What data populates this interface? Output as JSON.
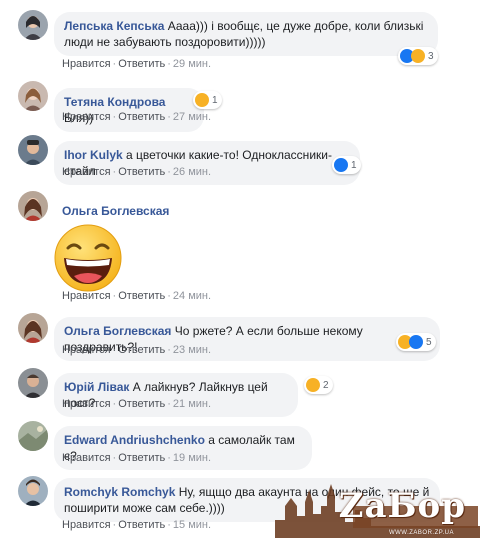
{
  "comments": [
    {
      "author": "Лепська Кепська",
      "text": "Аааа))) і вообщє, це дуже добре, коли близькі люди не забувають поздоровити)))))",
      "like_label": "Нравится",
      "reply_label": "Ответить",
      "time": "29 мин.",
      "reaction_count": "3",
      "reaction_icons": [
        "like-icon",
        "haha-icon"
      ]
    },
    {
      "author": "Тетяна Кондрова",
      "text": "Бля))",
      "like_label": "Нравится",
      "reply_label": "Ответить",
      "time": "27 мин.",
      "reaction_count": "1",
      "reaction_icons": [
        "haha-icon"
      ]
    },
    {
      "author": "Ihor Kulyk",
      "text": "а цветочки какие-то! Одноклассники-стайл",
      "like_label": "Нравится",
      "reply_label": "Ответить",
      "time": "26 мин.",
      "reaction_count": "1",
      "reaction_icons": [
        "like-icon"
      ]
    },
    {
      "author": "Ольга Боглевская",
      "text": "",
      "sticker": "laughing-face-sticker",
      "like_label": "Нравится",
      "reply_label": "Ответить",
      "time": "24 мин."
    },
    {
      "author": "Ольга Боглевская",
      "text": "Чо ржете? А если больше некому поздравить?!",
      "like_label": "Нравится",
      "reply_label": "Ответить",
      "time": "23 мин.",
      "reaction_count": "5",
      "reaction_icons": [
        "haha-icon",
        "like-icon"
      ]
    },
    {
      "author": "Юрій Лівак",
      "text": "А лайкнув? Лайкнув цей пост?",
      "like_label": "Нравится",
      "reply_label": "Ответить",
      "time": "21 мин.",
      "reaction_count": "2",
      "reaction_icons": [
        "haha-icon"
      ]
    },
    {
      "author": "Edward Andriushchenko",
      "text": "а самолайк там є?",
      "like_label": "Нравится",
      "reply_label": "Ответить",
      "time": "19 мин."
    },
    {
      "author": "Romchyk Romchyk",
      "text": "Ну, ящщо два акаунта на один фейс, то ще й поширити може сам себе.))))",
      "like_label": "Нравится",
      "reply_label": "Ответить",
      "time": "15 мин."
    }
  ],
  "separator": "·",
  "watermark": {
    "text": "ZаБор",
    "url": "WWW.ZABOR.ZP.UA"
  },
  "colors": {
    "author": "#385898",
    "bubble": "#f2f3f5",
    "meta": "#90949c",
    "like": "#1877f2",
    "haha": "#f7b125"
  }
}
